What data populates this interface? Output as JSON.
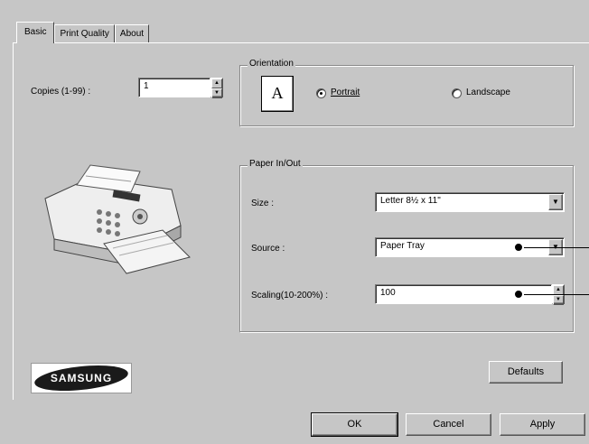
{
  "tabs": [
    "Basic",
    "Print Quality",
    "About"
  ],
  "copies": {
    "label": "Copies (1-99) :",
    "value": "1"
  },
  "orientation": {
    "group_label": "Orientation",
    "preview_letter": "A",
    "portrait_label": "Portrait",
    "landscape_label": "Landscape",
    "selected": "portrait"
  },
  "paper": {
    "group_label": "Paper In/Out",
    "size_label": "Size :",
    "size_value": "Letter 8½ x 11\"",
    "source_label": "Source :",
    "source_value": "Paper Tray",
    "scaling_label": "Scaling(10-200%) :",
    "scaling_value": "100"
  },
  "brand": "SAMSUNG",
  "buttons": {
    "defaults": "Defaults",
    "ok": "OK",
    "cancel": "Cancel",
    "apply": "Apply"
  }
}
